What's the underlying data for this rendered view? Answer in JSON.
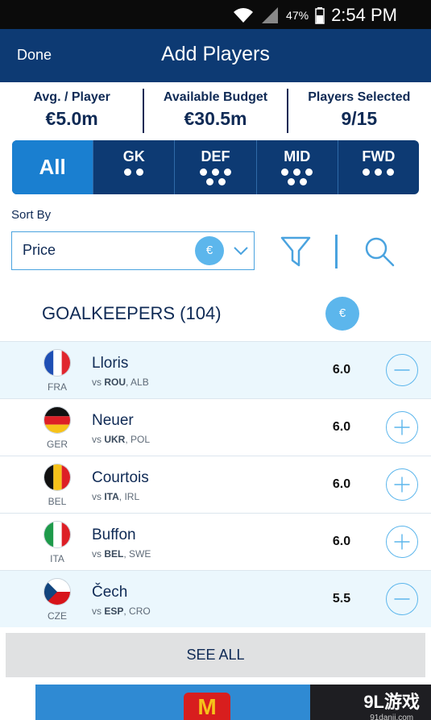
{
  "status_bar": {
    "battery_percent": "47%",
    "time": "2:54 PM"
  },
  "header": {
    "done_label": "Done",
    "title": "Add Players"
  },
  "stats": [
    {
      "label": "Avg. / Player",
      "value": "€5.0m"
    },
    {
      "label": "Available Budget",
      "value": "€30.5m"
    },
    {
      "label": "Players Selected",
      "value": "9/15"
    }
  ],
  "tabs": [
    {
      "label": "All",
      "active": true
    },
    {
      "label": "GK"
    },
    {
      "label": "DEF"
    },
    {
      "label": "MID"
    },
    {
      "label": "FWD"
    }
  ],
  "sort": {
    "label": "Sort By",
    "value": "Price",
    "currency_symbol": "€"
  },
  "section": {
    "title": "GOALKEEPERS (104)",
    "currency_symbol": "€"
  },
  "players": [
    {
      "name": "Lloris",
      "country": "FRA",
      "opponent_1": "ROU",
      "opponent_2": "ALB",
      "price": "6.0",
      "selected": true,
      "action": "remove"
    },
    {
      "name": "Neuer",
      "country": "GER",
      "opponent_1": "UKR",
      "opponent_2": "POL",
      "price": "6.0",
      "selected": false,
      "action": "add"
    },
    {
      "name": "Courtois",
      "country": "BEL",
      "opponent_1": "ITA",
      "opponent_2": "IRL",
      "price": "6.0",
      "selected": false,
      "action": "add"
    },
    {
      "name": "Buffon",
      "country": "ITA",
      "opponent_1": "BEL",
      "opponent_2": "SWE",
      "price": "6.0",
      "selected": false,
      "action": "add"
    },
    {
      "name": "Čech",
      "country": "CZE",
      "opponent_1": "ESP",
      "opponent_2": "CRO",
      "price": "5.5",
      "selected": true,
      "action": "remove"
    }
  ],
  "vs_prefix": "vs",
  "see_all_label": "SEE ALL",
  "ad": {
    "logo_letter": "M"
  },
  "watermark": {
    "brand": "9L游戏",
    "url": "91danji.com"
  },
  "colors": {
    "header": "#0d3a73",
    "accent": "#1a7fd0",
    "light_accent": "#5cb6ec",
    "selected_row": "#ebf7fd"
  }
}
